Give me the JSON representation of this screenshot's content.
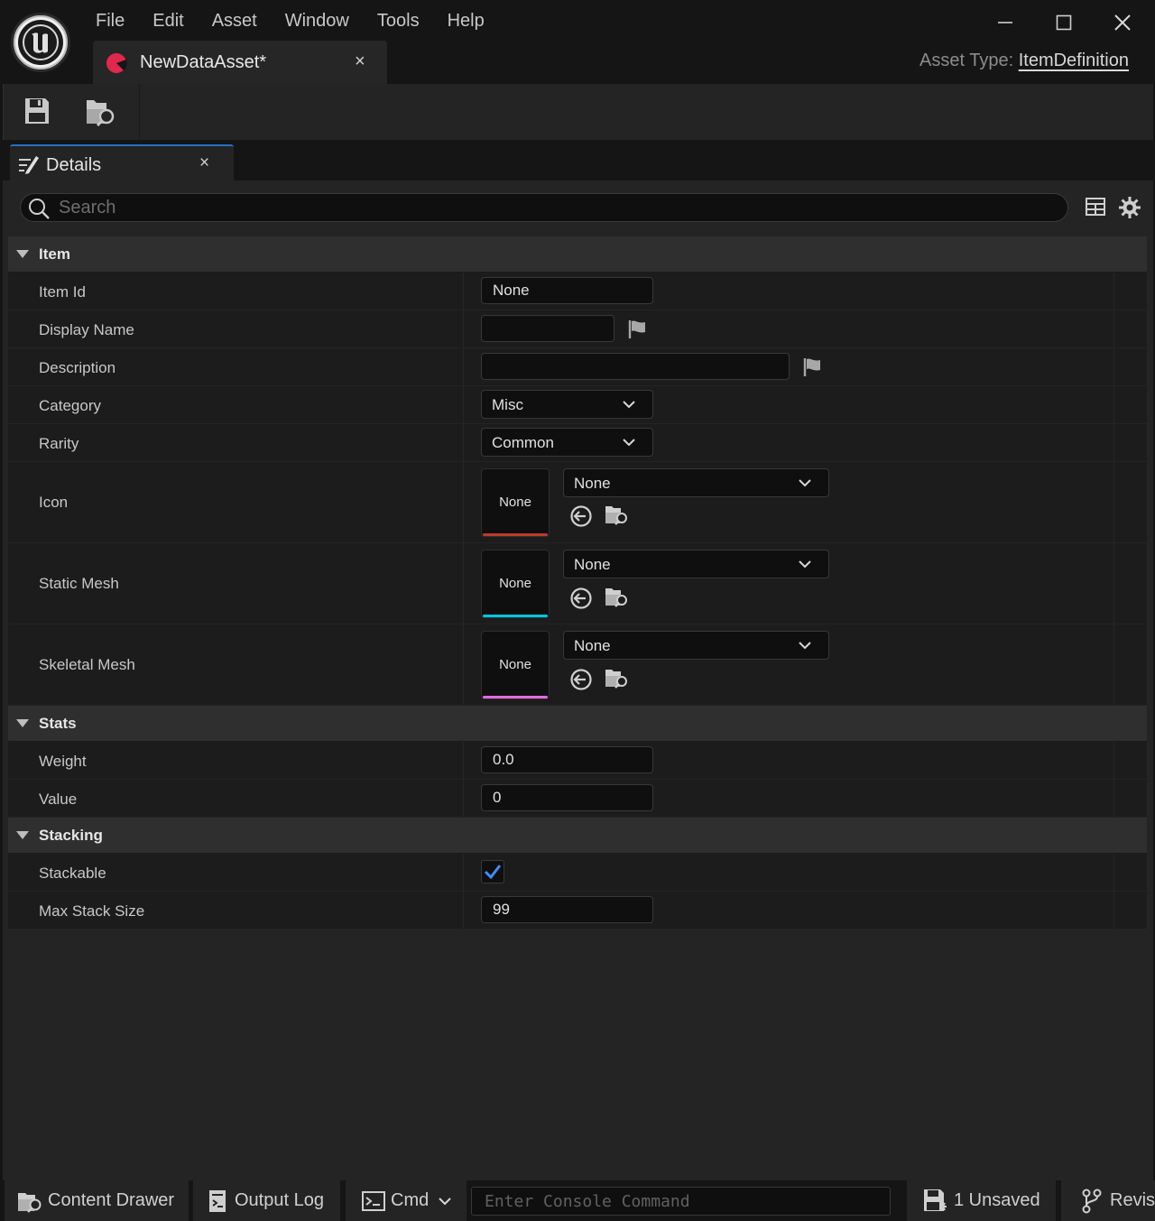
{
  "app": {
    "menu": [
      "File",
      "Edit",
      "Asset",
      "Window",
      "Tools",
      "Help"
    ],
    "document_tab": "NewDataAsset*",
    "document_tab_close": "×",
    "asset_type_label": "Asset Type:",
    "asset_type_value": "ItemDefinition"
  },
  "toolbar": {
    "icons": [
      "save-icon",
      "browse-to-asset-icon"
    ]
  },
  "details": {
    "tab_label": "Details",
    "tab_close": "×",
    "search_placeholder": "Search",
    "view_icons": [
      "table-view-icon",
      "settings-gear-icon"
    ]
  },
  "categories": {
    "item": "Item",
    "stats": "Stats",
    "stacking": "Stacking"
  },
  "properties": {
    "item_id": {
      "label": "Item Id",
      "value": "None"
    },
    "display_name": {
      "label": "Display Name",
      "value": ""
    },
    "description": {
      "label": "Description",
      "value": ""
    },
    "category": {
      "label": "Category",
      "value": "Misc"
    },
    "rarity": {
      "label": "Rarity",
      "value": "Common"
    },
    "icon": {
      "label": "Icon",
      "thumb": "None",
      "value": "None",
      "accent": "#c0392b"
    },
    "static_mesh": {
      "label": "Static Mesh",
      "thumb": "None",
      "value": "None",
      "accent": "#00c8e0"
    },
    "skeletal_mesh": {
      "label": "Skeletal Mesh",
      "thumb": "None",
      "value": "None",
      "accent": "#e36be0"
    },
    "weight": {
      "label": "Weight",
      "value": "0.0"
    },
    "value": {
      "label": "Value",
      "value": "0"
    },
    "stackable": {
      "label": "Stackable",
      "checked": true
    },
    "max_stack_size": {
      "label": "Max Stack Size",
      "value": "99"
    }
  },
  "statusbar": {
    "content_drawer": "Content Drawer",
    "output_log": "Output Log",
    "cmd": "Cmd",
    "console_placeholder": "Enter Console Command",
    "unsaved": "1 Unsaved",
    "revision": "Revis"
  },
  "colors": {
    "accent_blue": "#2a6fc4",
    "tab_dot": "#e0284f",
    "checkmark": "#3d8eff"
  }
}
